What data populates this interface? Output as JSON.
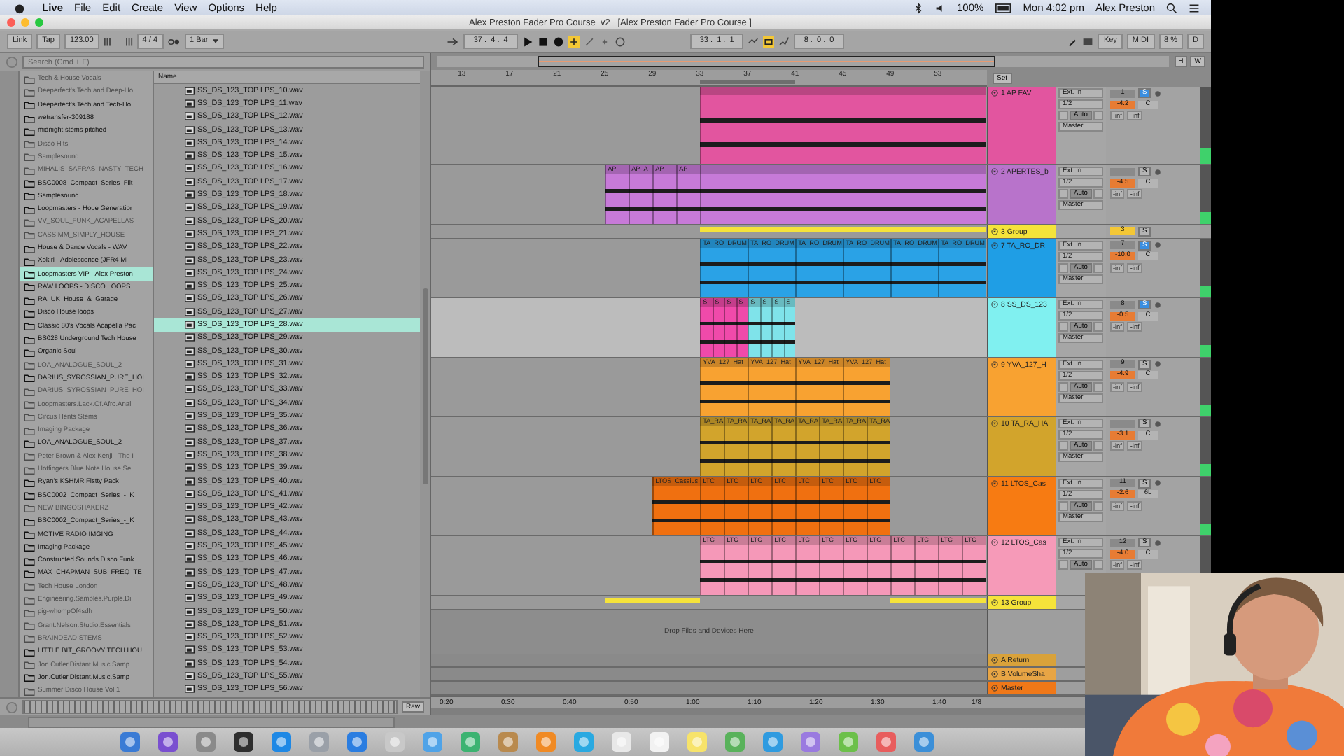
{
  "menu_bar": {
    "app": "Live",
    "items": [
      "File",
      "Edit",
      "Create",
      "View",
      "Options",
      "Help"
    ],
    "battery": "100%",
    "clock": "Mon 4:02 pm",
    "user": "Alex Preston"
  },
  "window": {
    "title": "Alex Preston Fader Pro Course  v2   [Alex Preston Fader Pro Course ]"
  },
  "control_bar": {
    "link": "Link",
    "tap": "Tap",
    "tempo": "123.00",
    "signature": "4 / 4",
    "quantize": "1 Bar",
    "position": "37 .  4 .  4",
    "loop_start": "33 .  1 .  1",
    "loop_length": "8 .  0 .  0",
    "key": "Key",
    "midi": "MIDI",
    "cpu": "8 %",
    "disk": "D"
  },
  "browser": {
    "search": {
      "placeholder": "Search (Cmd + F)"
    },
    "column": "Name",
    "preview": "Raw",
    "places": [
      {
        "name": "Tech & House Vocals",
        "available": false,
        "selected": false
      },
      {
        "name": "Deeperfect's Tech and Deep-Ho",
        "available": false,
        "selected": false
      },
      {
        "name": "Deeperfect's Tech and Tech-Ho",
        "available": true,
        "selected": false
      },
      {
        "name": "wetransfer-309188",
        "available": true,
        "selected": false
      },
      {
        "name": "midnight stems pitched",
        "available": true,
        "selected": false
      },
      {
        "name": "Disco Hits",
        "available": false,
        "selected": false
      },
      {
        "name": "Samplesound",
        "available": false,
        "selected": false
      },
      {
        "name": "MIHALIS_SAFRAS_NASTY_TECH",
        "available": false,
        "selected": false
      },
      {
        "name": "BSC0008_Compact_Series_Filt",
        "available": true,
        "selected": false
      },
      {
        "name": "Samplesound",
        "available": true,
        "selected": false
      },
      {
        "name": "Loopmasters - Houe Generatior",
        "available": true,
        "selected": false
      },
      {
        "name": "VV_SOUL_FUNK_ACAPELLAS",
        "available": false,
        "selected": false
      },
      {
        "name": "CASSIMM_SIMPLY_HOUSE",
        "available": false,
        "selected": false
      },
      {
        "name": "House & Dance Vocals - WAV",
        "available": true,
        "selected": false
      },
      {
        "name": "Xokiri - Adolescence (JFR4 Mi",
        "available": true,
        "selected": false
      },
      {
        "name": "Loopmasters VIP - Alex Preston",
        "available": true,
        "selected": true
      },
      {
        "name": "RAW LOOPS - DISCO LOOPS",
        "available": true,
        "selected": false
      },
      {
        "name": "RA_UK_House_&_Garage",
        "available": true,
        "selected": false
      },
      {
        "name": "Disco House loops",
        "available": true,
        "selected": false
      },
      {
        "name": "Classic 80's Vocals Acapella Pac",
        "available": true,
        "selected": false
      },
      {
        "name": "BS028 Underground Tech House",
        "available": true,
        "selected": false
      },
      {
        "name": "Organic Soul",
        "available": true,
        "selected": false
      },
      {
        "name": "LOA_ANALOGUE_SOUL_2",
        "available": false,
        "selected": false
      },
      {
        "name": "DARIUS_SYROSSIAN_PURE_HOI",
        "available": true,
        "selected": false
      },
      {
        "name": "DARIUS_SYROSSIAN_PURE_HOI",
        "available": false,
        "selected": false
      },
      {
        "name": "Loopmasters.Lack.Of.Afro.Anal",
        "available": false,
        "selected": false
      },
      {
        "name": "Circus Hents Stems",
        "available": false,
        "selected": false
      },
      {
        "name": "Imaging Package",
        "available": false,
        "selected": false
      },
      {
        "name": "LOA_ANALOGUE_SOUL_2",
        "available": true,
        "selected": false
      },
      {
        "name": "Peter Brown & Alex Kenji - The I",
        "available": false,
        "selected": false
      },
      {
        "name": "Hotfingers.Blue.Note.House.Se",
        "available": false,
        "selected": false
      },
      {
        "name": "Ryan's KSHMR Fistty Pack",
        "available": true,
        "selected": false
      },
      {
        "name": "BSC0002_Compact_Series_-_K",
        "available": true,
        "selected": false
      },
      {
        "name": "NEW BINGOSHAKERZ",
        "available": false,
        "selected": false
      },
      {
        "name": "BSC0002_Compact_Series_-_K",
        "available": true,
        "selected": false
      },
      {
        "name": "MOTIVE RADIO IMGING",
        "available": true,
        "selected": false
      },
      {
        "name": "Imaging Package",
        "available": true,
        "selected": false
      },
      {
        "name": "Constructed Sounds Disco Funk",
        "available": true,
        "selected": false
      },
      {
        "name": "MAX_CHAPMAN_SUB_FREQ_TE",
        "available": true,
        "selected": false
      },
      {
        "name": "Tech House London",
        "available": false,
        "selected": false
      },
      {
        "name": "Engineering.Samples.Purple.Di",
        "available": false,
        "selected": false
      },
      {
        "name": "pig-whompOf4sdh",
        "available": false,
        "selected": false
      },
      {
        "name": "Grant.Nelson.Studio.Essentials",
        "available": false,
        "selected": false
      },
      {
        "name": "BRAINDEAD STEMS",
        "available": false,
        "selected": false
      },
      {
        "name": "LITTLE BIT_GROOVY TECH HOU",
        "available": true,
        "selected": false
      },
      {
        "name": "Jon.Cutler.Distant.Music.Samp",
        "available": false,
        "selected": false
      },
      {
        "name": "Jon.Cutler.Distant.Music.Samp",
        "available": true,
        "selected": false
      },
      {
        "name": "Summer Disco House Vol 1",
        "available": false,
        "selected": false
      }
    ],
    "files": [
      {
        "name": "SS_DS_123_TOP LPS_10.wav",
        "selected": false
      },
      {
        "name": "SS_DS_123_TOP LPS_11.wav",
        "selected": false
      },
      {
        "name": "SS_DS_123_TOP LPS_12.wav",
        "selected": false
      },
      {
        "name": "SS_DS_123_TOP LPS_13.wav",
        "selected": false
      },
      {
        "name": "SS_DS_123_TOP LPS_14.wav",
        "selected": false
      },
      {
        "name": "SS_DS_123_TOP LPS_15.wav",
        "selected": false
      },
      {
        "name": "SS_DS_123_TOP LPS_16.wav",
        "selected": false
      },
      {
        "name": "SS_DS_123_TOP LPS_17.wav",
        "selected": false
      },
      {
        "name": "SS_DS_123_TOP LPS_18.wav",
        "selected": false
      },
      {
        "name": "SS_DS_123_TOP LPS_19.wav",
        "selected": false
      },
      {
        "name": "SS_DS_123_TOP LPS_20.wav",
        "selected": false
      },
      {
        "name": "SS_DS_123_TOP LPS_21.wav",
        "selected": false
      },
      {
        "name": "SS_DS_123_TOP LPS_22.wav",
        "selected": false
      },
      {
        "name": "SS_DS_123_TOP LPS_23.wav",
        "selected": false
      },
      {
        "name": "SS_DS_123_TOP LPS_24.wav",
        "selected": false
      },
      {
        "name": "SS_DS_123_TOP LPS_25.wav",
        "selected": false
      },
      {
        "name": "SS_DS_123_TOP LPS_26.wav",
        "selected": false
      },
      {
        "name": "SS_DS_123_TOP LPS_27.wav",
        "selected": false
      },
      {
        "name": "SS_DS_123_TOP LPS_28.wav",
        "selected": true
      },
      {
        "name": "SS_DS_123_TOP LPS_29.wav",
        "selected": false
      },
      {
        "name": "SS_DS_123_TOP LPS_30.wav",
        "selected": false
      },
      {
        "name": "SS_DS_123_TOP LPS_31.wav",
        "selected": false
      },
      {
        "name": "SS_DS_123_TOP LPS_32.wav",
        "selected": false
      },
      {
        "name": "SS_DS_123_TOP LPS_33.wav",
        "selected": false
      },
      {
        "name": "SS_DS_123_TOP LPS_34.wav",
        "selected": false
      },
      {
        "name": "SS_DS_123_TOP LPS_35.wav",
        "selected": false
      },
      {
        "name": "SS_DS_123_TOP LPS_36.wav",
        "selected": false
      },
      {
        "name": "SS_DS_123_TOP LPS_37.wav",
        "selected": false
      },
      {
        "name": "SS_DS_123_TOP LPS_38.wav",
        "selected": false
      },
      {
        "name": "SS_DS_123_TOP LPS_39.wav",
        "selected": false
      },
      {
        "name": "SS_DS_123_TOP LPS_40.wav",
        "selected": false
      },
      {
        "name": "SS_DS_123_TOP LPS_41.wav",
        "selected": false
      },
      {
        "name": "SS_DS_123_TOP LPS_42.wav",
        "selected": false
      },
      {
        "name": "SS_DS_123_TOP LPS_43.wav",
        "selected": false
      },
      {
        "name": "SS_DS_123_TOP LPS_44.wav",
        "selected": false
      },
      {
        "name": "SS_DS_123_TOP LPS_45.wav",
        "selected": false
      },
      {
        "name": "SS_DS_123_TOP LPS_46.wav",
        "selected": false
      },
      {
        "name": "SS_DS_123_TOP LPS_47.wav",
        "selected": false
      },
      {
        "name": "SS_DS_123_TOP LPS_48.wav",
        "selected": false
      },
      {
        "name": "SS_DS_123_TOP LPS_49.wav",
        "selected": false
      },
      {
        "name": "SS_DS_123_TOP LPS_50.wav",
        "selected": false
      },
      {
        "name": "SS_DS_123_TOP LPS_51.wav",
        "selected": false
      },
      {
        "name": "SS_DS_123_TOP LPS_52.wav",
        "selected": false
      },
      {
        "name": "SS_DS_123_TOP LPS_53.wav",
        "selected": false
      },
      {
        "name": "SS_DS_123_TOP LPS_54.wav",
        "selected": false
      },
      {
        "name": "SS_DS_123_TOP LPS_55.wav",
        "selected": false
      },
      {
        "name": "SS_DS_123_TOP LPS_56.wav",
        "selected": false
      }
    ]
  },
  "arrangement": {
    "set": "Set",
    "fit_buttons": [
      "H",
      "W"
    ],
    "ruler": [
      "13",
      "17",
      "21",
      "25",
      "29",
      "33",
      "37",
      "41",
      "45",
      "49",
      "53"
    ],
    "drop_hint": "Drop Files and Devices Here",
    "time_ruler": [
      "0:20",
      "0:30",
      "0:40",
      "0:50",
      "1:00",
      "1:10",
      "1:20",
      "1:30",
      "1:40"
    ],
    "zoom": "1/8",
    "tracks": [
      {
        "kind": "audio",
        "name": "1 AP FAV",
        "color": "#e2559f",
        "selected": false,
        "input": "Ext. In",
        "channel": "1/2",
        "monitor": "Auto",
        "output": "Master",
        "number": "1",
        "solo": "S",
        "soloed": true,
        "volume": "-4.2",
        "pan": "C",
        "sends": [
          "-inf",
          "-inf"
        ],
        "clips": [
          {
            "color": "#e2559f"
          }
        ]
      },
      {
        "kind": "audio",
        "name": "2 APERTES_b",
        "color": "#b873cb",
        "selected": false,
        "input": "Ext. In",
        "channel": "1/2",
        "monitor": "Auto",
        "output": "Master",
        "solo": "S",
        "soloed": false,
        "volume": "-4.5",
        "pan": "C",
        "sends": [
          "-inf",
          "-inf"
        ],
        "clips": [
          {
            "label": "AP",
            "color": "#c77ad8"
          },
          {
            "label": "AP_A",
            "color": "#c77ad8"
          },
          {
            "label": "AP_",
            "color": "#c77ad8"
          },
          {
            "label": "AP",
            "color": "#c77ad8"
          },
          {
            "color": "#c77ad8"
          }
        ]
      },
      {
        "kind": "group",
        "name": "3 Group",
        "color": "#f5e33a",
        "selected": false,
        "number": "3",
        "solo": "S",
        "soloed": false,
        "clips": [
          {
            "color": "#f5e33a"
          }
        ]
      },
      {
        "kind": "audio",
        "name": "7 TA_RO_DR",
        "color": "#1f9ee5",
        "selected": false,
        "input": "Ext. In",
        "channel": "1/2",
        "monitor": "Auto",
        "output": "Master",
        "number": "7",
        "solo": "S",
        "soloed": true,
        "volume": "-10.0",
        "pan": "C",
        "sends": [
          "-inf",
          "-inf"
        ],
        "clips": [
          {
            "label": "TA_RO_DRUM",
            "color": "#2aa2e6"
          },
          {
            "label": "TA_RO_DRUM",
            "color": "#2aa2e6"
          },
          {
            "label": "TA_RO_DRUM",
            "color": "#2aa2e6"
          },
          {
            "label": "TA_RO_DRUM",
            "color": "#2aa2e6"
          },
          {
            "label": "TA_RO_DRUM",
            "color": "#2aa2e6"
          },
          {
            "label": "TA_RO_DRUM",
            "color": "#2aa2e6"
          }
        ]
      },
      {
        "kind": "audio",
        "name": "8 SS_DS_123",
        "color": "#80f0f0",
        "selected": true,
        "input": "Ext. In",
        "channel": "1/2",
        "monitor": "Auto",
        "output": "Master",
        "number": "8",
        "solo": "S",
        "soloed": true,
        "volume": "-0.5",
        "pan": "C",
        "sends": [
          "-inf",
          "-inf"
        ],
        "clips": [
          {
            "label": "S",
            "color": "#f04aaa"
          },
          {
            "label": "S",
            "color": "#f04aaa"
          },
          {
            "label": "S",
            "color": "#f04aaa"
          },
          {
            "label": "S",
            "color": "#f04aaa"
          },
          {
            "label": "S",
            "color": "#7fe3ea"
          },
          {
            "label": "S",
            "color": "#7fe3ea"
          },
          {
            "label": "S",
            "color": "#7fe3ea"
          },
          {
            "label": "S",
            "color": "#7fe3ea"
          }
        ]
      },
      {
        "kind": "audio",
        "name": "9 YVA_127_H",
        "color": "#f8a231",
        "selected": false,
        "input": "Ext. In",
        "channel": "1/2",
        "monitor": "Auto",
        "output": "Master",
        "number": "9",
        "solo": "S",
        "soloed": false,
        "volume": "-4.9",
        "pan": "C",
        "sends": [
          "-inf",
          "-inf"
        ],
        "clips": [
          {
            "label": "YVA_127_Hat",
            "color": "#f8a231"
          },
          {
            "label": "YVA_127_Hat",
            "color": "#f8a231"
          },
          {
            "label": "YVA_127_Hat",
            "color": "#f8a231"
          },
          {
            "label": "YVA_127_Hat",
            "color": "#f8a231"
          }
        ]
      },
      {
        "kind": "audio",
        "name": "10 TA_RA_HA",
        "color": "#d2a42c",
        "selected": false,
        "input": "Ext. In",
        "channel": "1/2",
        "monitor": "Auto",
        "output": "Master",
        "solo": "S",
        "soloed": false,
        "volume": "-3.1",
        "pan": "C",
        "sends": [
          "-inf",
          "-inf"
        ],
        "clips": [
          {
            "label": "TA_RA",
            "color": "#d2a42c"
          },
          {
            "label": "TA_RA",
            "color": "#d2a42c"
          },
          {
            "label": "TA_RA",
            "color": "#d2a42c"
          },
          {
            "label": "TA_RA",
            "color": "#d2a42c"
          },
          {
            "label": "TA_RA",
            "color": "#d2a42c"
          },
          {
            "label": "TA_RA",
            "color": "#d2a42c"
          },
          {
            "label": "TA_RA",
            "color": "#d2a42c"
          },
          {
            "label": "TA_RA",
            "color": "#d2a42c"
          }
        ]
      },
      {
        "kind": "audio",
        "name": "11 LTOS_Cas",
        "color": "#f77b12",
        "selected": false,
        "input": "Ext. In",
        "channel": "1/2",
        "monitor": "Auto",
        "output": "Master",
        "number": "11",
        "solo": "S",
        "soloed": false,
        "volume": "-2.6",
        "pan": "6L",
        "sends": [
          "-inf",
          "-inf"
        ],
        "clips": [
          {
            "label": "LTOS_Cassius",
            "color": "#f07010"
          },
          {
            "label": "LTC",
            "color": "#f07010"
          },
          {
            "label": "LTC",
            "color": "#f07010"
          },
          {
            "label": "LTC",
            "color": "#f07010"
          },
          {
            "label": "LTC",
            "color": "#f07010"
          },
          {
            "label": "LTC",
            "color": "#f07010"
          },
          {
            "label": "LTC",
            "color": "#f07010"
          },
          {
            "label": "LTC",
            "color": "#f07010"
          },
          {
            "label": "LTC",
            "color": "#f07010"
          }
        ]
      },
      {
        "kind": "audio",
        "name": "12 LTOS_Cas",
        "color": "#f69ab8",
        "selected": false,
        "input": "Ext. In",
        "channel": "1/2",
        "monitor": "Auto",
        "number": "12",
        "solo": "S",
        "soloed": false,
        "volume": "-4.0",
        "pan": "C",
        "sends": [
          "-inf",
          "-inf"
        ],
        "clips": [
          {
            "label": "LTC",
            "color": "#f598b8"
          },
          {
            "label": "LTC",
            "color": "#f598b8"
          },
          {
            "label": "LTC",
            "color": "#f598b8"
          },
          {
            "label": "LTC",
            "color": "#f598b8"
          },
          {
            "label": "LTC",
            "color": "#f598b8"
          },
          {
            "label": "LTC",
            "color": "#f598b8"
          },
          {
            "label": "LTC",
            "color": "#f598b8"
          },
          {
            "label": "LTC",
            "color": "#f598b8"
          },
          {
            "label": "LTC",
            "color": "#f598b8"
          },
          {
            "label": "LTC",
            "color": "#f598b8"
          },
          {
            "label": "LTC",
            "color": "#f598b8"
          },
          {
            "label": "LTC",
            "color": "#f598b8"
          }
        ]
      },
      {
        "kind": "group",
        "name": "13 Group",
        "color": "#f5e33a",
        "selected": false,
        "clips": [
          {
            "color": "#f5e33a"
          },
          {
            "color": "#f5e33a"
          }
        ]
      }
    ],
    "returns": [
      {
        "name": "A Return",
        "color": "#d9a23a"
      },
      {
        "name": "B VolumeSha",
        "color": "#e8a545"
      },
      {
        "name": "Master",
        "color": "#f07818"
      }
    ]
  }
}
